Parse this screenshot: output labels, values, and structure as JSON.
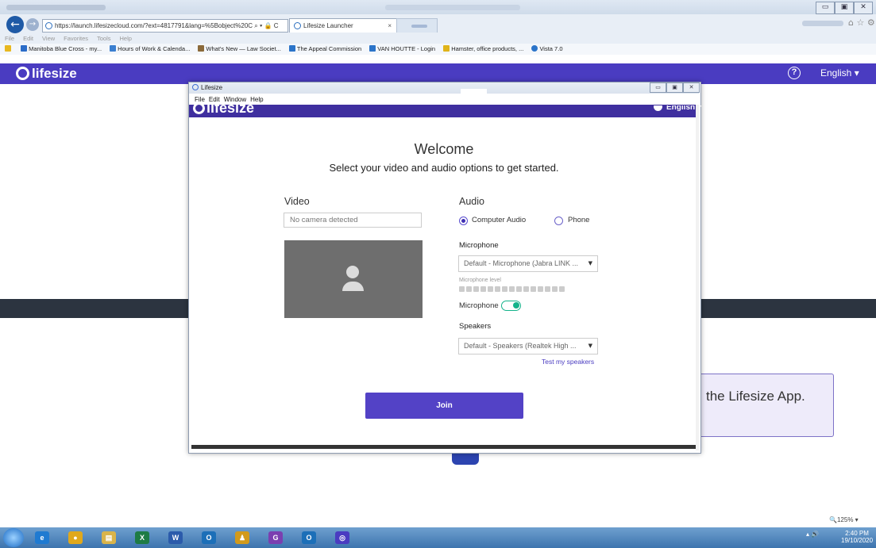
{
  "browser": {
    "url": "https://launch.lifesizecloud.com/?ext=4817791&lang=%5Bobject%20C",
    "tabs": [
      {
        "title": "Lifesize Launcher",
        "close": "×"
      }
    ],
    "menu": [
      "File",
      "Edit",
      "View",
      "Favorites",
      "Tools",
      "Help"
    ],
    "favorites": [
      "Manitoba Blue Cross - my...",
      "Hours of Work & Calenda...",
      "What's New — Law Societ...",
      "The Appeal Commission",
      "VAN HOUTTE - Login",
      "Hamster, office products, ...",
      "Vista 7.0"
    ],
    "win_buttons": [
      "▭",
      "▣",
      "✕"
    ],
    "address_icons": "⌕ ▾ 🔒 C"
  },
  "page": {
    "logo": "lifesize",
    "help_icon": "?",
    "language": "English ▾",
    "launch_text": "the Lifesize App."
  },
  "modal": {
    "title": "Lifesize",
    "menu": [
      "File",
      "Edit",
      "Window",
      "Help"
    ],
    "logo": "lifesize",
    "language": "English ▾",
    "welcome": "Welcome",
    "subtitle": "Select your video and audio options to get started.",
    "video": {
      "label": "Video",
      "camera": "No camera detected"
    },
    "audio": {
      "label": "Audio",
      "options": [
        {
          "label": "Computer Audio",
          "selected": true
        },
        {
          "label": "Phone",
          "selected": false
        }
      ],
      "microphone_label": "Microphone",
      "microphone_value": "Default - Microphone (Jabra LINK ...",
      "mic_level_label": "Microphone level",
      "mic_level_segments": 15,
      "mic_toggle_label": "Microphone",
      "mic_toggle_on": true,
      "speakers_label": "Speakers",
      "speakers_value": "Default - Speakers (Realtek High ...",
      "test_speakers": "Test my speakers"
    },
    "join": "Join",
    "win_buttons": [
      "▭",
      "▣",
      "✕"
    ]
  },
  "status": {
    "zoom": "125%"
  },
  "taskbar": {
    "time": "2:40 PM",
    "date": "19/10/2020",
    "apps": [
      {
        "name": "internet-explorer",
        "glyph": "e",
        "color": "#1f7ad1"
      },
      {
        "name": "chrome",
        "glyph": "●",
        "color": "#e0a81c"
      },
      {
        "name": "file-explorer",
        "glyph": "▤",
        "color": "#d9b44a"
      },
      {
        "name": "excel",
        "glyph": "X",
        "color": "#1e7b45"
      },
      {
        "name": "word",
        "glyph": "W",
        "color": "#2b5bab"
      },
      {
        "name": "outlook",
        "glyph": "O",
        "color": "#1c6fb8"
      },
      {
        "name": "people",
        "glyph": "♟",
        "color": "#d29a1c"
      },
      {
        "name": "pdf-app",
        "glyph": "G",
        "color": "#7b3fb0"
      },
      {
        "name": "outlook-2",
        "glyph": "O",
        "color": "#1c6fb8"
      },
      {
        "name": "lifesize",
        "glyph": "◎",
        "color": "#4a3cc1"
      }
    ]
  }
}
